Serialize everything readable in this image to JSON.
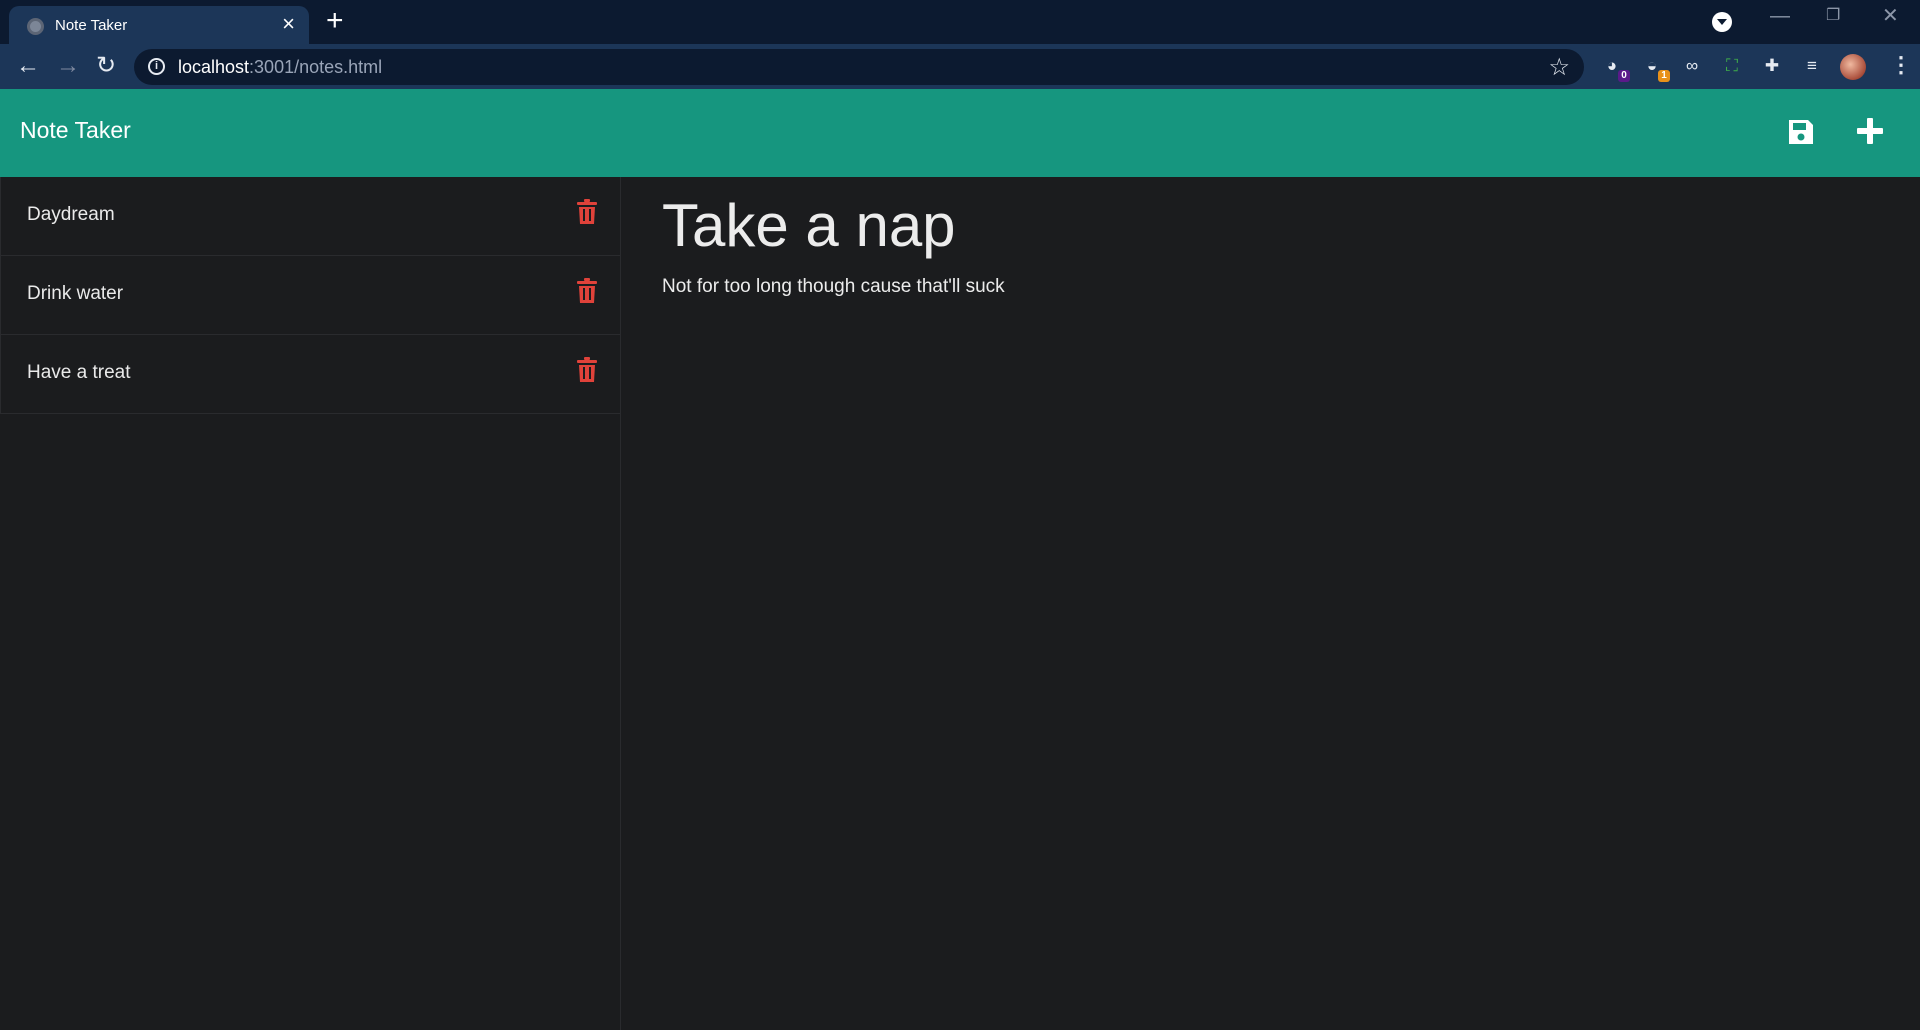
{
  "browser": {
    "tab_title": "Note Taker",
    "url_host": "localhost",
    "url_rest": ":3001/notes.html",
    "extensions": [
      {
        "icon": "ghostery-icon",
        "badge": "0",
        "badge_color": "#5a1a8a"
      },
      {
        "icon": "cookie-icon",
        "badge": "1",
        "badge_color": "#e8911a"
      },
      {
        "icon": "mask-icon",
        "badge": null,
        "badge_color": null
      },
      {
        "icon": "screenshot-icon",
        "badge": null,
        "badge_color": null
      },
      {
        "icon": "puzzle-icon",
        "badge": null,
        "badge_color": null
      },
      {
        "icon": "media-control-icon",
        "badge": null,
        "badge_color": null
      }
    ]
  },
  "app": {
    "brand": "Note Taker",
    "accent_color": "#16967f",
    "delete_color": "#e0423a"
  },
  "notes": [
    {
      "title": "Daydream"
    },
    {
      "title": "Drink water"
    },
    {
      "title": "Have a treat"
    }
  ],
  "active_note": {
    "title": "Take a nap",
    "text": "Not for too long though cause that'll suck"
  }
}
